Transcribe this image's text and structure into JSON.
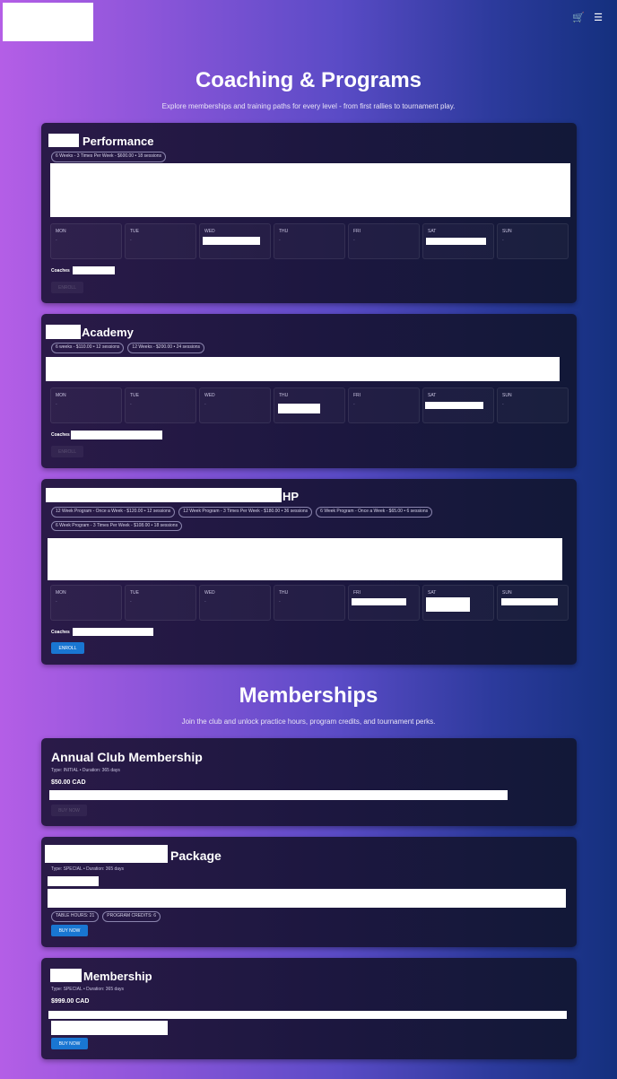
{
  "header": {
    "cart_icon": "shopping-cart-icon",
    "menu_icon": "hamburger-menu-icon"
  },
  "coaching": {
    "title": "Coaching & Programs",
    "subtitle": "Explore memberships and training paths for every level - from first rallies to tournament play."
  },
  "days": [
    "MON",
    "TUE",
    "WED",
    "THU",
    "FRI",
    "SAT",
    "SUN"
  ],
  "day_placeholder": "-",
  "programs": [
    {
      "title_suffix": "Performance",
      "pills": [
        "6 Weeks - 3 Times Per Week - $600.00 • 18 sessions"
      ],
      "coaches_label": "Coaches",
      "button": "ENROLL"
    },
    {
      "title_suffix": "Academy",
      "pills": [
        "6 weeks - $110.00 • 12 sessions",
        "12 Weeks - $200.00 • 24 sessions"
      ],
      "coaches_label": "Coaches",
      "button": "ENROLL"
    },
    {
      "title_suffix": "HP",
      "pills": [
        "12 Week Program - Once a Week - $120.00 • 12 sessions",
        "12 Week Program - 3 Times Per Week - $180.00 • 36 sessions",
        "6 Week Program - Once a Week - $65.00 • 6 sessions",
        "6 Week Program - 3 Times Per Week - $108.00 • 18 sessions"
      ],
      "coaches_label": "Coaches",
      "button": "ENROLL"
    }
  ],
  "memberships_section": {
    "title": "Memberships",
    "subtitle": "Join the club and unlock practice hours, program credits, and tournament perks."
  },
  "memberships": [
    {
      "title": "Annual Club Membership",
      "meta": "Type: INITIAL • Duration: 365 days",
      "price": "$50.00 CAD",
      "button": "BUY NOW"
    },
    {
      "title_suffix": "Package",
      "meta": "Type: SPECIAL • Duration: 365 days",
      "pills": [
        "TABLE HOURS: 21",
        "PROGRAM CREDITS: 6"
      ],
      "button": "BUY NOW"
    },
    {
      "title_suffix": "Membership",
      "meta": "Type: SPECIAL • Duration: 365 days",
      "price": "$999.00 CAD",
      "button": "BUY NOW"
    }
  ],
  "colors": {
    "accent_button": "#1976d2",
    "card_bg": "#1d1740",
    "gradient_start": "#b45ee6",
    "gradient_end": "#14307e"
  }
}
